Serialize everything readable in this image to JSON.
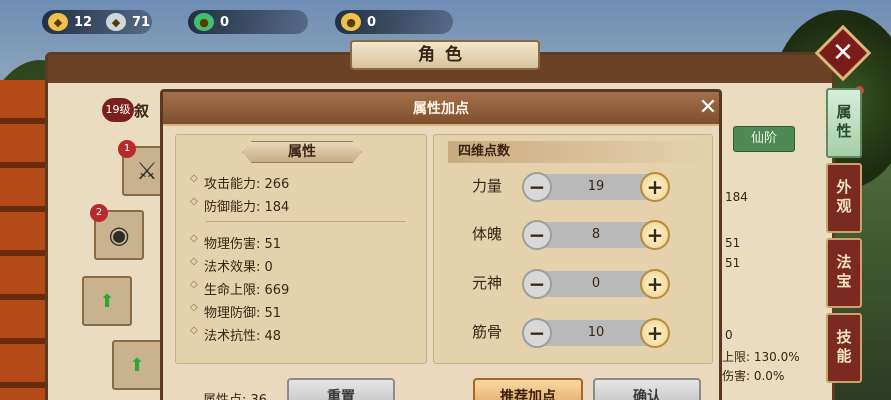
{
  "resources": [
    {
      "name": "gold-ingot",
      "value": "12",
      "color": "#f1c04a"
    },
    {
      "name": "silver-ingot",
      "value": "71",
      "color": "#cfd6dd"
    },
    {
      "name": "jade",
      "value": "0",
      "color": "#3fbf6f"
    },
    {
      "name": "coin",
      "value": "0",
      "color": "#f1c04a"
    }
  ],
  "character_window": {
    "title": "角色",
    "level": "19级",
    "name_partial": "叙",
    "right_button": "仙阶",
    "right_values": [
      "184",
      "51",
      "51",
      "0"
    ],
    "right_stats": [
      "上限: 130.0%",
      "伤害: 0.0%"
    ],
    "slot_badges": [
      "1",
      "2"
    ]
  },
  "side_tabs": [
    "属性",
    "外观",
    "法宝",
    "技能"
  ],
  "dialog": {
    "title": "属性加点",
    "attributes_heading": "属性",
    "attack": "攻击能力: 266",
    "defense": "防御能力: 184",
    "stats": [
      "物理伤害: 51",
      "法术效果: 0",
      "生命上限: 669",
      "物理防御: 51",
      "法术抗性: 48"
    ],
    "four_dim_label": "四维点数",
    "rows": [
      {
        "label": "力量",
        "value": "19"
      },
      {
        "label": "体魄",
        "value": "8"
      },
      {
        "label": "元神",
        "value": "0"
      },
      {
        "label": "筋骨",
        "value": "10"
      }
    ],
    "points_text": "属性点: 36",
    "btn_reset": "重置",
    "btn_recommend": "推荐加点",
    "btn_confirm": "确认"
  }
}
